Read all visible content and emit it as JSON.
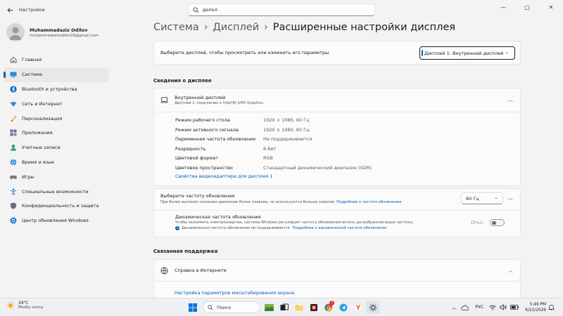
{
  "window": {
    "app_title": "Настройки",
    "search_value": "допол",
    "controls": {
      "minimize": "—",
      "maximize": "▢",
      "close": "✕"
    }
  },
  "user": {
    "name": "Muhammadaziz Odilov",
    "email": "muhammadazizodilov16@gmail.com"
  },
  "nav": {
    "items": [
      {
        "label": "Главная",
        "icon": "home-icon"
      },
      {
        "label": "Система",
        "icon": "system-icon",
        "active": true
      },
      {
        "label": "Bluetooth и устройства",
        "icon": "bluetooth-icon"
      },
      {
        "label": "Сеть и Интернет",
        "icon": "network-icon"
      },
      {
        "label": "Персонализация",
        "icon": "brush-icon"
      },
      {
        "label": "Приложения",
        "icon": "apps-icon"
      },
      {
        "label": "Учетные записи",
        "icon": "account-icon"
      },
      {
        "label": "Время и язык",
        "icon": "globe-clock-icon"
      },
      {
        "label": "Игры",
        "icon": "gamepad-icon"
      },
      {
        "label": "Специальные возможности",
        "icon": "accessibility-icon"
      },
      {
        "label": "Конфиденциальность и защита",
        "icon": "shield-icon"
      },
      {
        "label": "Центр обновления Windows",
        "icon": "update-icon"
      }
    ]
  },
  "breadcrumb": {
    "part1": "Система",
    "part2": "Дисплей",
    "current": "Расширенные настройки дисплея",
    "sep": "›"
  },
  "display_select": {
    "label": "Выберите дисплей, чтобы просмотреть или изменить его параметры",
    "value": "Дисплей 1: Внутренний дисплей"
  },
  "display_info": {
    "section_title": "Сведения о дисплее",
    "title": "Внутренний дисплей",
    "subtitle": "Дисплей 1: подключен к Intel(R) UHD Graphics",
    "specs": [
      {
        "key": "Режим рабочего стола",
        "value": "1920 × 1080, 60 Гц"
      },
      {
        "key": "Режим активного сигнала",
        "value": "1920 × 1080, 60 Гц"
      },
      {
        "key": "Переменная частота обновления",
        "value": "Не поддерживается"
      },
      {
        "key": "Разрядность",
        "value": "6-бит"
      },
      {
        "key": "Цветовой формат",
        "value": "RGB"
      },
      {
        "key": "Цветовое пространство",
        "value": "Стандартный динамический диапазон (SDR)"
      }
    ],
    "adapter_link": "Свойства видеоадаптера для дисплея 1"
  },
  "refresh": {
    "title": "Выберите частоту обновления",
    "subtitle": "При более высоком значении движение более плавное, но используется больше энергии",
    "subtitle_link": "Подробнее о частоте обновления",
    "value": "60 Гц",
    "dynamic_title": "Динамическая частота обновления",
    "dynamic_desc": "Чтобы экономить электроэнергию, система Windows регулирует частоту обновления вплоть до выбранной выше частоты.",
    "dynamic_note": "Динамическая частота обновления не поддерживается",
    "dynamic_link": "Подробнее о динамической частоте обновления",
    "toggle_label": "Откл.",
    "toggle_on": false
  },
  "support": {
    "section_title": "Связанная поддержка",
    "title": "Справка в Интернете",
    "link": "Настройка параметров масштабирования экрана"
  },
  "taskbar": {
    "weather_temp": "34°C",
    "weather_desc": "Mostly sunny",
    "search_label": "Поиск",
    "language": "РУС",
    "time": "5:49 PM",
    "date": "6/22/2026",
    "chrome_badge": "7"
  },
  "colors": {
    "accent": "#005fb8",
    "background": "#f3f3f3",
    "card": "#fbfbfb"
  }
}
